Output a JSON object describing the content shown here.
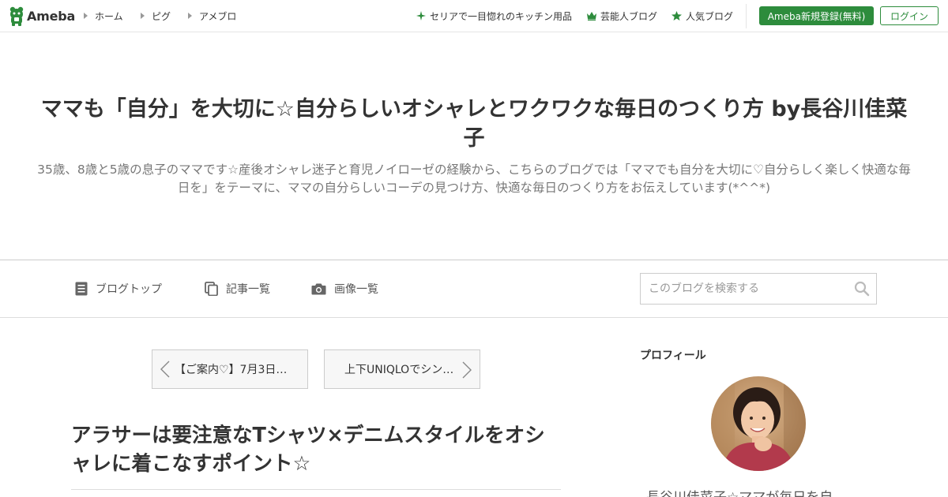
{
  "header": {
    "logo_text": "Ameba",
    "nav": [
      {
        "label": "ホーム"
      },
      {
        "label": "ピグ"
      },
      {
        "label": "アメブロ"
      }
    ],
    "right_links": [
      {
        "label": "セリアで一目惚れのキッチン用品",
        "icon": "sparkle-icon"
      },
      {
        "label": "芸能人ブログ",
        "icon": "crown-icon"
      },
      {
        "label": "人気ブログ",
        "icon": "star-icon"
      }
    ],
    "register_label": "Ameba新規登録(無料)",
    "login_label": "ログイン",
    "accent_color": "#2d8c3c"
  },
  "blog": {
    "title": "ママも「自分」を大切に☆自分らしいオシャレとワクワクな毎日のつくり方 by長谷川佳菜子",
    "description": "35歳、8歳と5歳の息子のママです☆産後オシャレ迷子と育児ノイローゼの経験から、こちらのブログでは「ママでも自分を大切に♡自分らしく楽しく快適な毎日を」をテーマに、ママの自分らしいコーデの見つけ方、快適な毎日のつくり方をお伝えしています(*^^*)"
  },
  "blog_nav": {
    "items": [
      {
        "label": "ブログトップ",
        "icon": "document-icon"
      },
      {
        "label": "記事一覧",
        "icon": "copy-icon"
      },
      {
        "label": "画像一覧",
        "icon": "camera-icon"
      }
    ],
    "search_placeholder": "このブログを検索する"
  },
  "pager": {
    "prev_label": "【ご案内♡】7月3日…",
    "next_label": "上下UNIQLOでシン…"
  },
  "article": {
    "title": "アラサーは要注意なTシャツ×デニムスタイルをオシャレに着こなすポイント☆"
  },
  "sidebar": {
    "profile_heading": "プロフィール",
    "profile_name": "長谷川佳菜子☆ママが毎日を自"
  }
}
